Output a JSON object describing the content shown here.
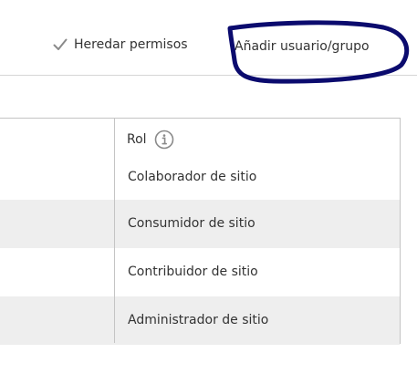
{
  "toolbar": {
    "inherit_label": "Heredar permisos",
    "add_label": "Añadir usuario/grupo"
  },
  "table": {
    "role_header": "Rol",
    "rows": [
      {
        "role": "Colaborador de sitio"
      },
      {
        "role": "Consumidor de sitio"
      },
      {
        "role": "Contribuidor de sitio"
      },
      {
        "role": "Administrador de sitio"
      }
    ]
  },
  "colors": {
    "annotation": "#0b0b6e",
    "row_shade": "#eeeeee",
    "border": "#c4c4c4",
    "text": "#333333"
  },
  "icons": {
    "inherit": "check-icon",
    "role_info": "info-icon"
  }
}
